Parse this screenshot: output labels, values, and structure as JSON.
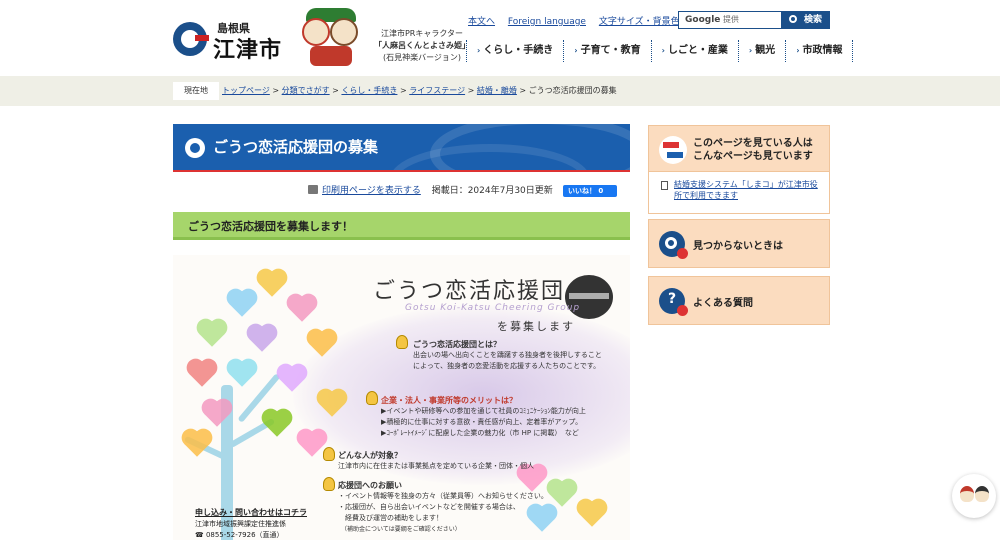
{
  "header": {
    "logo_pref": "島根県",
    "logo_city": "江津市",
    "mascot_caption": [
      "江津市PRキャラクター",
      "「人麻呂くんとよさみ姫」",
      "(石見神楽バージョン)"
    ],
    "top_links": [
      "本文へ",
      "Foreign language",
      "文字サイズ・背景色変更"
    ],
    "search_placeholder": "提供",
    "search_brand": "Google",
    "search_button": "検索",
    "nav": [
      "くらし・手続き",
      "子育て・教育",
      "しごと・産業",
      "観光",
      "市政情報"
    ]
  },
  "breadcrumb": {
    "label": "現在地",
    "items": [
      "トップページ",
      "分類でさがす",
      "くらし・手続き",
      "ライフステージ",
      "結婚・離婚"
    ],
    "current": "ごうつ恋活応援団の募集"
  },
  "main": {
    "title": "ごうつ恋活応援団の募集",
    "print_link": "印刷用ページを表示する",
    "published": "掲載日：2024年7月30日更新",
    "like_label": "いいね！ 0",
    "subheading": "ごうつ恋活応援団を募集します！"
  },
  "poster": {
    "title": "ごうつ恋活応援団",
    "subtitle": "Gotsu Koi-Katsu Cheering Group",
    "recruit": "を募集します",
    "sec1_head": "ごうつ恋活応援団とは？",
    "sec1_body": [
      "出会いの場へ出向くことを躊躇する独身者を後押しすること",
      "によって、独身者の恋愛活動を応援する人たちのことです。"
    ],
    "sec2_head": "企業・法人・事業所等のメリットは？",
    "sec2_body": [
      "▶イベントや研修等への参加を通じて社員のｺﾐｭﾆｹｰｼｮﾝ能力が向上",
      "▶積極的に仕事に対する意欲・責任感が向上、定着率がアップ。",
      "▶ｺｰﾎﾟﾚｰﾄｲﾒｰｼﾞに配慮した企業の魅力化（市 HP に掲載）　など"
    ],
    "sec3_head": "どんな人が対象？",
    "sec3_body": [
      "江津市内に在住または事業拠点を定めている企業・団体・個人"
    ],
    "sec4_head": "応援団へのお願い",
    "sec4_body": [
      "・イベント情報等を独身の方々（従業員等）へお知らせください。",
      "・応援団が、自ら出会いイベントなどを開催する場合は、",
      "　経費及び運営の補助をします！",
      "　（補助金については要綱をご確認ください）"
    ],
    "contact_head": "申し込み・問い合わせはコチラ",
    "contact_org": "江津市地域振興課定住推進係",
    "contact_tel": "☎ 0855-52-7926（直通）"
  },
  "sidebar": {
    "related_title": [
      "このページを見ている人は",
      "こんなページも見ています"
    ],
    "related_link": "結婚支援システム「しまコ」が江津市役所で利用できます",
    "not_found": "見つからないときは",
    "faq": "よくある質問"
  }
}
